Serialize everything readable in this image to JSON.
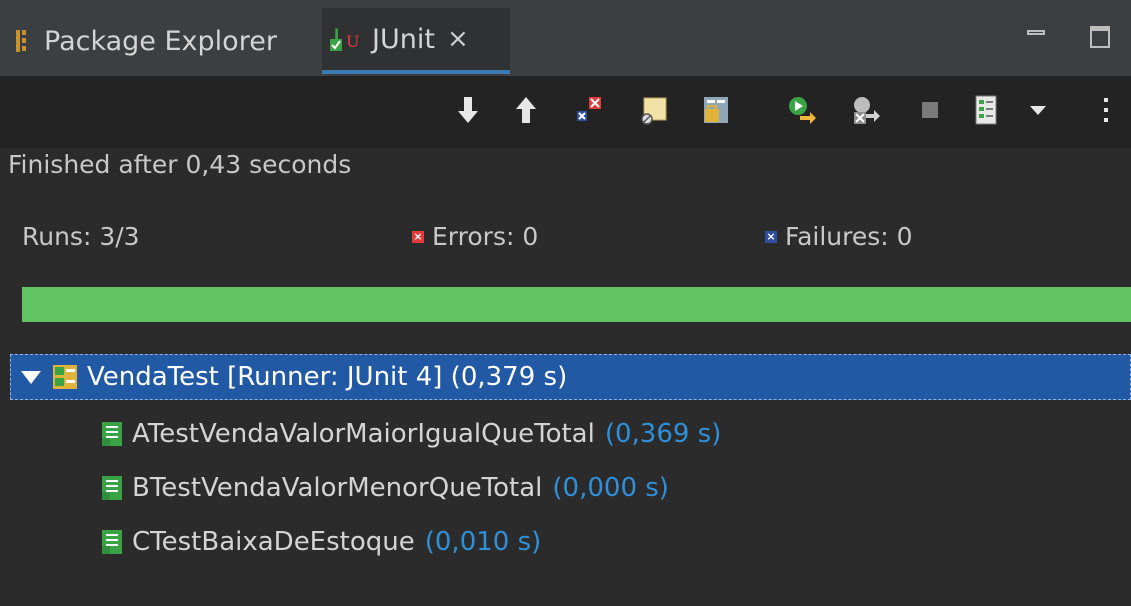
{
  "tabs": {
    "package_explorer": "Package Explorer",
    "junit": "JUnit",
    "close_glyph": "×"
  },
  "toolbar": {
    "icons": [
      "next-failure-icon",
      "previous-failure-icon",
      "show-failures-only-icon",
      "scroll-lock-icon",
      "show-skipped-icon",
      "rerun-test-icon",
      "rerun-failed-first-icon",
      "stop-icon",
      "test-run-history-icon",
      "history-dropdown-icon",
      "view-menu-icon"
    ]
  },
  "status": {
    "finished": "Finished after 0,43 seconds"
  },
  "counters": {
    "runs": "Runs:  3/3",
    "errors": "Errors:  0",
    "failures": "Failures:  0"
  },
  "progress": {
    "fraction": 1.0,
    "color": "#62c462"
  },
  "tree": {
    "root": {
      "label": "VendaTest [Runner: JUnit 4] (0,379 s)"
    },
    "children": [
      {
        "name": "ATestVendaValorMaiorIgualQueTotal",
        "time": "(0,369 s)"
      },
      {
        "name": "BTestVendaValorMenorQueTotal",
        "time": "(0,000 s)"
      },
      {
        "name": "CTestBaixaDeEstoque",
        "time": "(0,010 s)"
      }
    ]
  },
  "colors": {
    "accent_blue": "#2f90d9",
    "selected_row": "#2159a5",
    "success_green": "#62c462",
    "error_red": "#e23b3b"
  }
}
